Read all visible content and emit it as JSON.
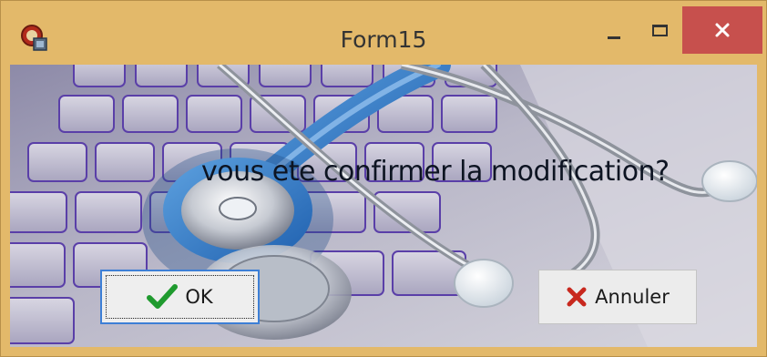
{
  "window": {
    "title": "Form15",
    "icons": {
      "app": "app-icon",
      "minimize": "minimize-icon",
      "maximize": "maximize-icon",
      "close": "close-icon"
    },
    "colors": {
      "frame": "#e3b96a",
      "close_button": "#c7504d",
      "ok_focus_border": "#3d7fd6"
    }
  },
  "dialog": {
    "message": "vous ete confirmer la modification?",
    "background_image": "stethoscope-on-keyboard"
  },
  "buttons": {
    "ok": {
      "label": "OK",
      "icon": "checkmark-icon",
      "focused": true
    },
    "cancel": {
      "label": "Annuler",
      "icon": "x-cross-icon"
    }
  }
}
